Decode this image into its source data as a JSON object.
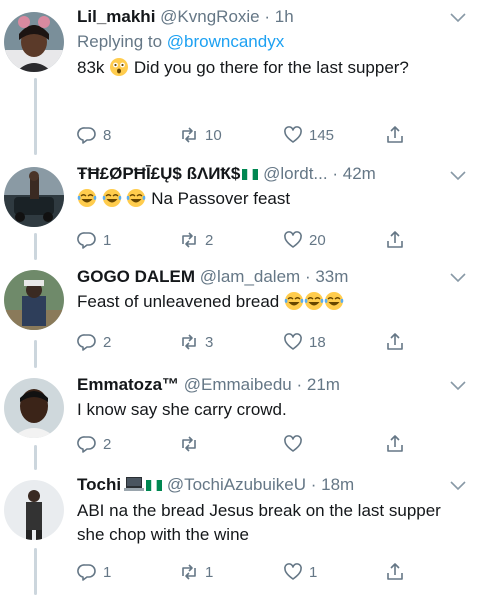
{
  "tweets": [
    {
      "name": "Lil_makhi",
      "handle": "@KvngRoxie",
      "dot": "·",
      "time": "1h",
      "replying_prefix": "Replying to ",
      "replying_to": "@browncandyx",
      "text_before": "83k",
      "text_after": "Did you go there for the last supper?",
      "emoji": [
        "astonished-face"
      ],
      "reply_count": "8",
      "retweet_count": "10",
      "like_count": "145"
    },
    {
      "name": "ŦĦ£ØPĦĪ£Ų$ ßΛИҞ$",
      "handle": "@lordt...",
      "dot": "·",
      "time": "42m",
      "flag": "nigeria",
      "text": "Na Passover feast",
      "emoji": [
        "tears-of-joy",
        "tears-of-joy",
        "tears-of-joy"
      ],
      "reply_count": "1",
      "retweet_count": "2",
      "like_count": "20"
    },
    {
      "name": "GOGO DALEM",
      "handle": "@lam_dalem",
      "dot": "·",
      "time": "33m",
      "text": "Feast of unleavened bread",
      "emoji": [
        "tears-of-joy",
        "tears-of-joy",
        "tears-of-joy"
      ],
      "reply_count": "2",
      "retweet_count": "3",
      "like_count": "18"
    },
    {
      "name": "Emmatoza™",
      "handle": "@Emmaibedu",
      "dot": "·",
      "time": "21m",
      "text": "I know say she carry crowd.",
      "reply_count": "2",
      "retweet_count": "",
      "like_count": ""
    },
    {
      "name": "Tochi",
      "handle": "@TochiAzubuikeU",
      "dot": "·",
      "time": "18m",
      "flag": "nigeria",
      "icon": "laptop-icon",
      "text": "ABI na the bread Jesus break on the last supper she chop with the wine",
      "reply_count": "1",
      "retweet_count": "1",
      "like_count": "1"
    }
  ],
  "colors": {
    "text": "#14171a",
    "secondary": "#657786",
    "link": "#1da1f2",
    "thread_line": "#ccd6dd",
    "flag_green": "#008751"
  }
}
